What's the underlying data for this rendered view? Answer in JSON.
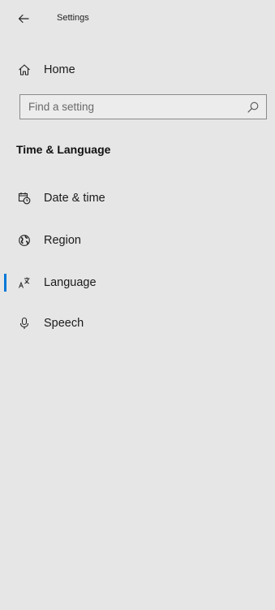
{
  "window": {
    "title": "Settings"
  },
  "nav": {
    "home_label": "Home"
  },
  "search": {
    "placeholder": "Find a setting",
    "value": ""
  },
  "section": {
    "title": "Time & Language"
  },
  "sidebar": {
    "items": [
      {
        "label": "Date & time",
        "icon": "date-time-icon",
        "active": false
      },
      {
        "label": "Region",
        "icon": "globe-icon",
        "active": false
      },
      {
        "label": "Language",
        "icon": "language-icon",
        "active": true
      },
      {
        "label": "Speech",
        "icon": "microphone-icon",
        "active": false
      }
    ]
  },
  "colors": {
    "background": "#e6e6e6",
    "accent": "#0078d7",
    "text": "#1a1a1a"
  }
}
